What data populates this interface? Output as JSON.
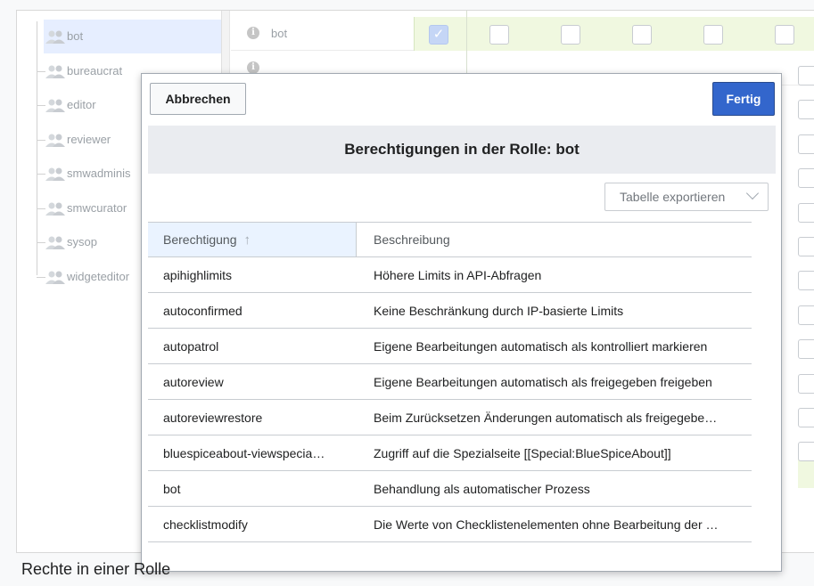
{
  "tree": {
    "items": [
      {
        "label": "bot"
      },
      {
        "label": "bureaucrat"
      },
      {
        "label": "editor"
      },
      {
        "label": "reviewer"
      },
      {
        "label": "smwadminis"
      },
      {
        "label": "smwcurator"
      },
      {
        "label": "sysop"
      },
      {
        "label": "widgeteditor"
      }
    ],
    "selected_index": 0
  },
  "grid": {
    "first_row_label": "bot"
  },
  "dialog": {
    "cancel_label": "Abbrechen",
    "done_label": "Fertig",
    "title": "Berechtigungen in der Rolle: bot",
    "export_label": "Tabelle exportieren",
    "columns": {
      "permission": "Berechtigung",
      "description": "Beschreibung"
    },
    "rows": [
      {
        "permission": "apihighlimits",
        "description": "Höhere Limits in API-Abfragen"
      },
      {
        "permission": "autoconfirmed",
        "description": "Keine Beschränkung durch IP-basierte Limits"
      },
      {
        "permission": "autopatrol",
        "description": "Eigene Bearbeitungen automatisch als kontrolliert markieren"
      },
      {
        "permission": "autoreview",
        "description": "Eigene Bearbeitungen automatisch als freigegeben freigeben"
      },
      {
        "permission": "autoreviewrestore",
        "description": "Beim Zurücksetzen Änderungen automatisch als freigegebe…"
      },
      {
        "permission": "bluespiceabout-viewspecia…",
        "description": "Zugriff auf die Spezialseite [[Special:BlueSpiceAbout]]"
      },
      {
        "permission": "bot",
        "description": "Behandlung als automatischer Prozess"
      },
      {
        "permission": "checklistmodify",
        "description": "Die Werte von Checklistenelementen ohne Bearbeitung der …"
      }
    ]
  },
  "caption": "Rechte in einer Rolle",
  "colors": {
    "accent": "#3366cc",
    "selected_row": "#e6eeff",
    "granted_area": "#f0f8e0"
  }
}
